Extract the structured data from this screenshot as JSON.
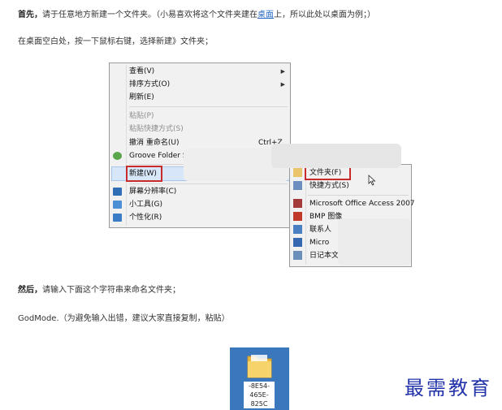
{
  "intro": {
    "lead": "首先，",
    "text": "请于任意地方新建一个文件夹。（小易喜欢将这个文件夹建在",
    "link": "桌面",
    "tail": "上，所以此处以桌面为例；）"
  },
  "step1": "在桌面空白处，按一下鼠标右键，选择新建》文件夹；",
  "context_menu": {
    "items": [
      {
        "label": "查看(V)",
        "submenu": true
      },
      {
        "label": "排序方式(O)",
        "submenu": true
      },
      {
        "label": "刷新(E)"
      },
      {
        "label": "粘贴(P)",
        "disabled": true
      },
      {
        "label": "粘贴快捷方式(S)",
        "disabled": true
      },
      {
        "label": "撤消 重命名(U)",
        "shortcut": "Ctrl+Z"
      },
      {
        "label": "Groove Folder Synchronization"
      },
      {
        "label": "新建(W)",
        "submenu": true
      },
      {
        "label": "屏幕分辨率(C)"
      },
      {
        "label": "小工具(G)"
      },
      {
        "label": "个性化(R)"
      }
    ],
    "submenu_arrow": "▶"
  },
  "new_submenu": {
    "items": [
      {
        "label": "文件夹(F)"
      },
      {
        "label": "快捷方式(S)"
      },
      {
        "label": "Microsoft Office Access 2007"
      },
      {
        "label": "BMP 图像"
      },
      {
        "label": "联系人"
      },
      {
        "label": "Micro"
      },
      {
        "label": "日记本文档"
      }
    ]
  },
  "step2": {
    "lead": "然后，",
    "text": "请输入下面这个字符串来命名文件夹；"
  },
  "step3": "GodMode.（为避免输入出错，建议大家直接复制，粘贴）",
  "folder": {
    "label": "-8E54-\n465E-\n825C"
  },
  "watermark": "最需教育"
}
